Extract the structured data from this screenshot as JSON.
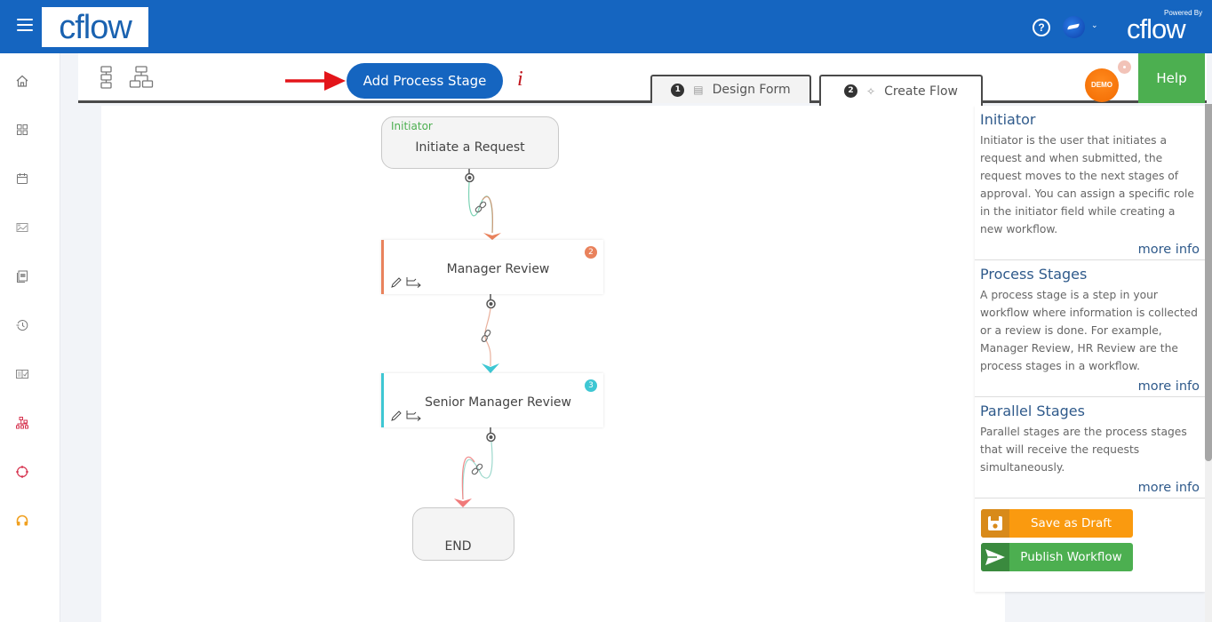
{
  "header": {
    "logo_text": "cflow",
    "help_icon": "question-circle-icon",
    "avatar_caret": "chevron-down-icon",
    "powered_by_label": "Powered By",
    "powered_by_logo": "cflow",
    "brand_color": "#1565c0"
  },
  "sidebar": {
    "items": [
      {
        "name": "home",
        "icon": "home-icon"
      },
      {
        "name": "dashboard",
        "icon": "grid-icon"
      },
      {
        "name": "calendar",
        "icon": "calendar-icon"
      },
      {
        "name": "reports",
        "icon": "chart-card-icon"
      },
      {
        "name": "documents",
        "icon": "documents-icon"
      },
      {
        "name": "history",
        "icon": "history-icon"
      },
      {
        "name": "approvals",
        "icon": "approval-card-icon"
      },
      {
        "name": "workflow",
        "icon": "workflow-icon",
        "color": "#d6334f"
      },
      {
        "name": "integrations",
        "icon": "crosshair-icon",
        "color": "#d6334f"
      },
      {
        "name": "support",
        "icon": "headset-icon",
        "color": "#f0a020"
      }
    ]
  },
  "toolbar": {
    "layout_vertical_icon": "vertical-layout-icon",
    "layout_tree_icon": "tree-layout-icon",
    "add_stage_label": "Add Process Stage",
    "info_label": "i",
    "tabs": [
      {
        "number": "1",
        "label": "Design Form",
        "icon": "form-icon",
        "active": false
      },
      {
        "number": "2",
        "label": "Create Flow",
        "icon": "flow-icon",
        "active": true
      }
    ],
    "demo_label": "DEMO",
    "help_label": "Help"
  },
  "flow": {
    "initiator": {
      "role": "Initiator",
      "title": "Initiate a Request"
    },
    "stages": [
      {
        "title": "Manager Review",
        "badge": "2",
        "color": "#e9825c"
      },
      {
        "title": "Senior Manager Review",
        "badge": "3",
        "color": "#3ec7d3"
      }
    ],
    "end": {
      "title": "END"
    }
  },
  "info_panel": {
    "sections": [
      {
        "title": "Initiator",
        "body": "Initiator is the user that initiates a request and when submitted, the request moves to the next stages of approval. You can assign a specific role in the initiator field while creating a new workflow.",
        "more": "more info"
      },
      {
        "title": "Process Stages",
        "body": "A process stage is a step in your workflow where information is collected or a review is done. For example, Manager Review, HR Review are the process stages in a workflow.",
        "more": "more info"
      },
      {
        "title": "Parallel Stages",
        "body": "Parallel stages are the process stages that will receive the requests simultaneously.",
        "more": "more info"
      }
    ],
    "save_draft_label": "Save as Draft",
    "publish_label": "Publish Workflow"
  }
}
